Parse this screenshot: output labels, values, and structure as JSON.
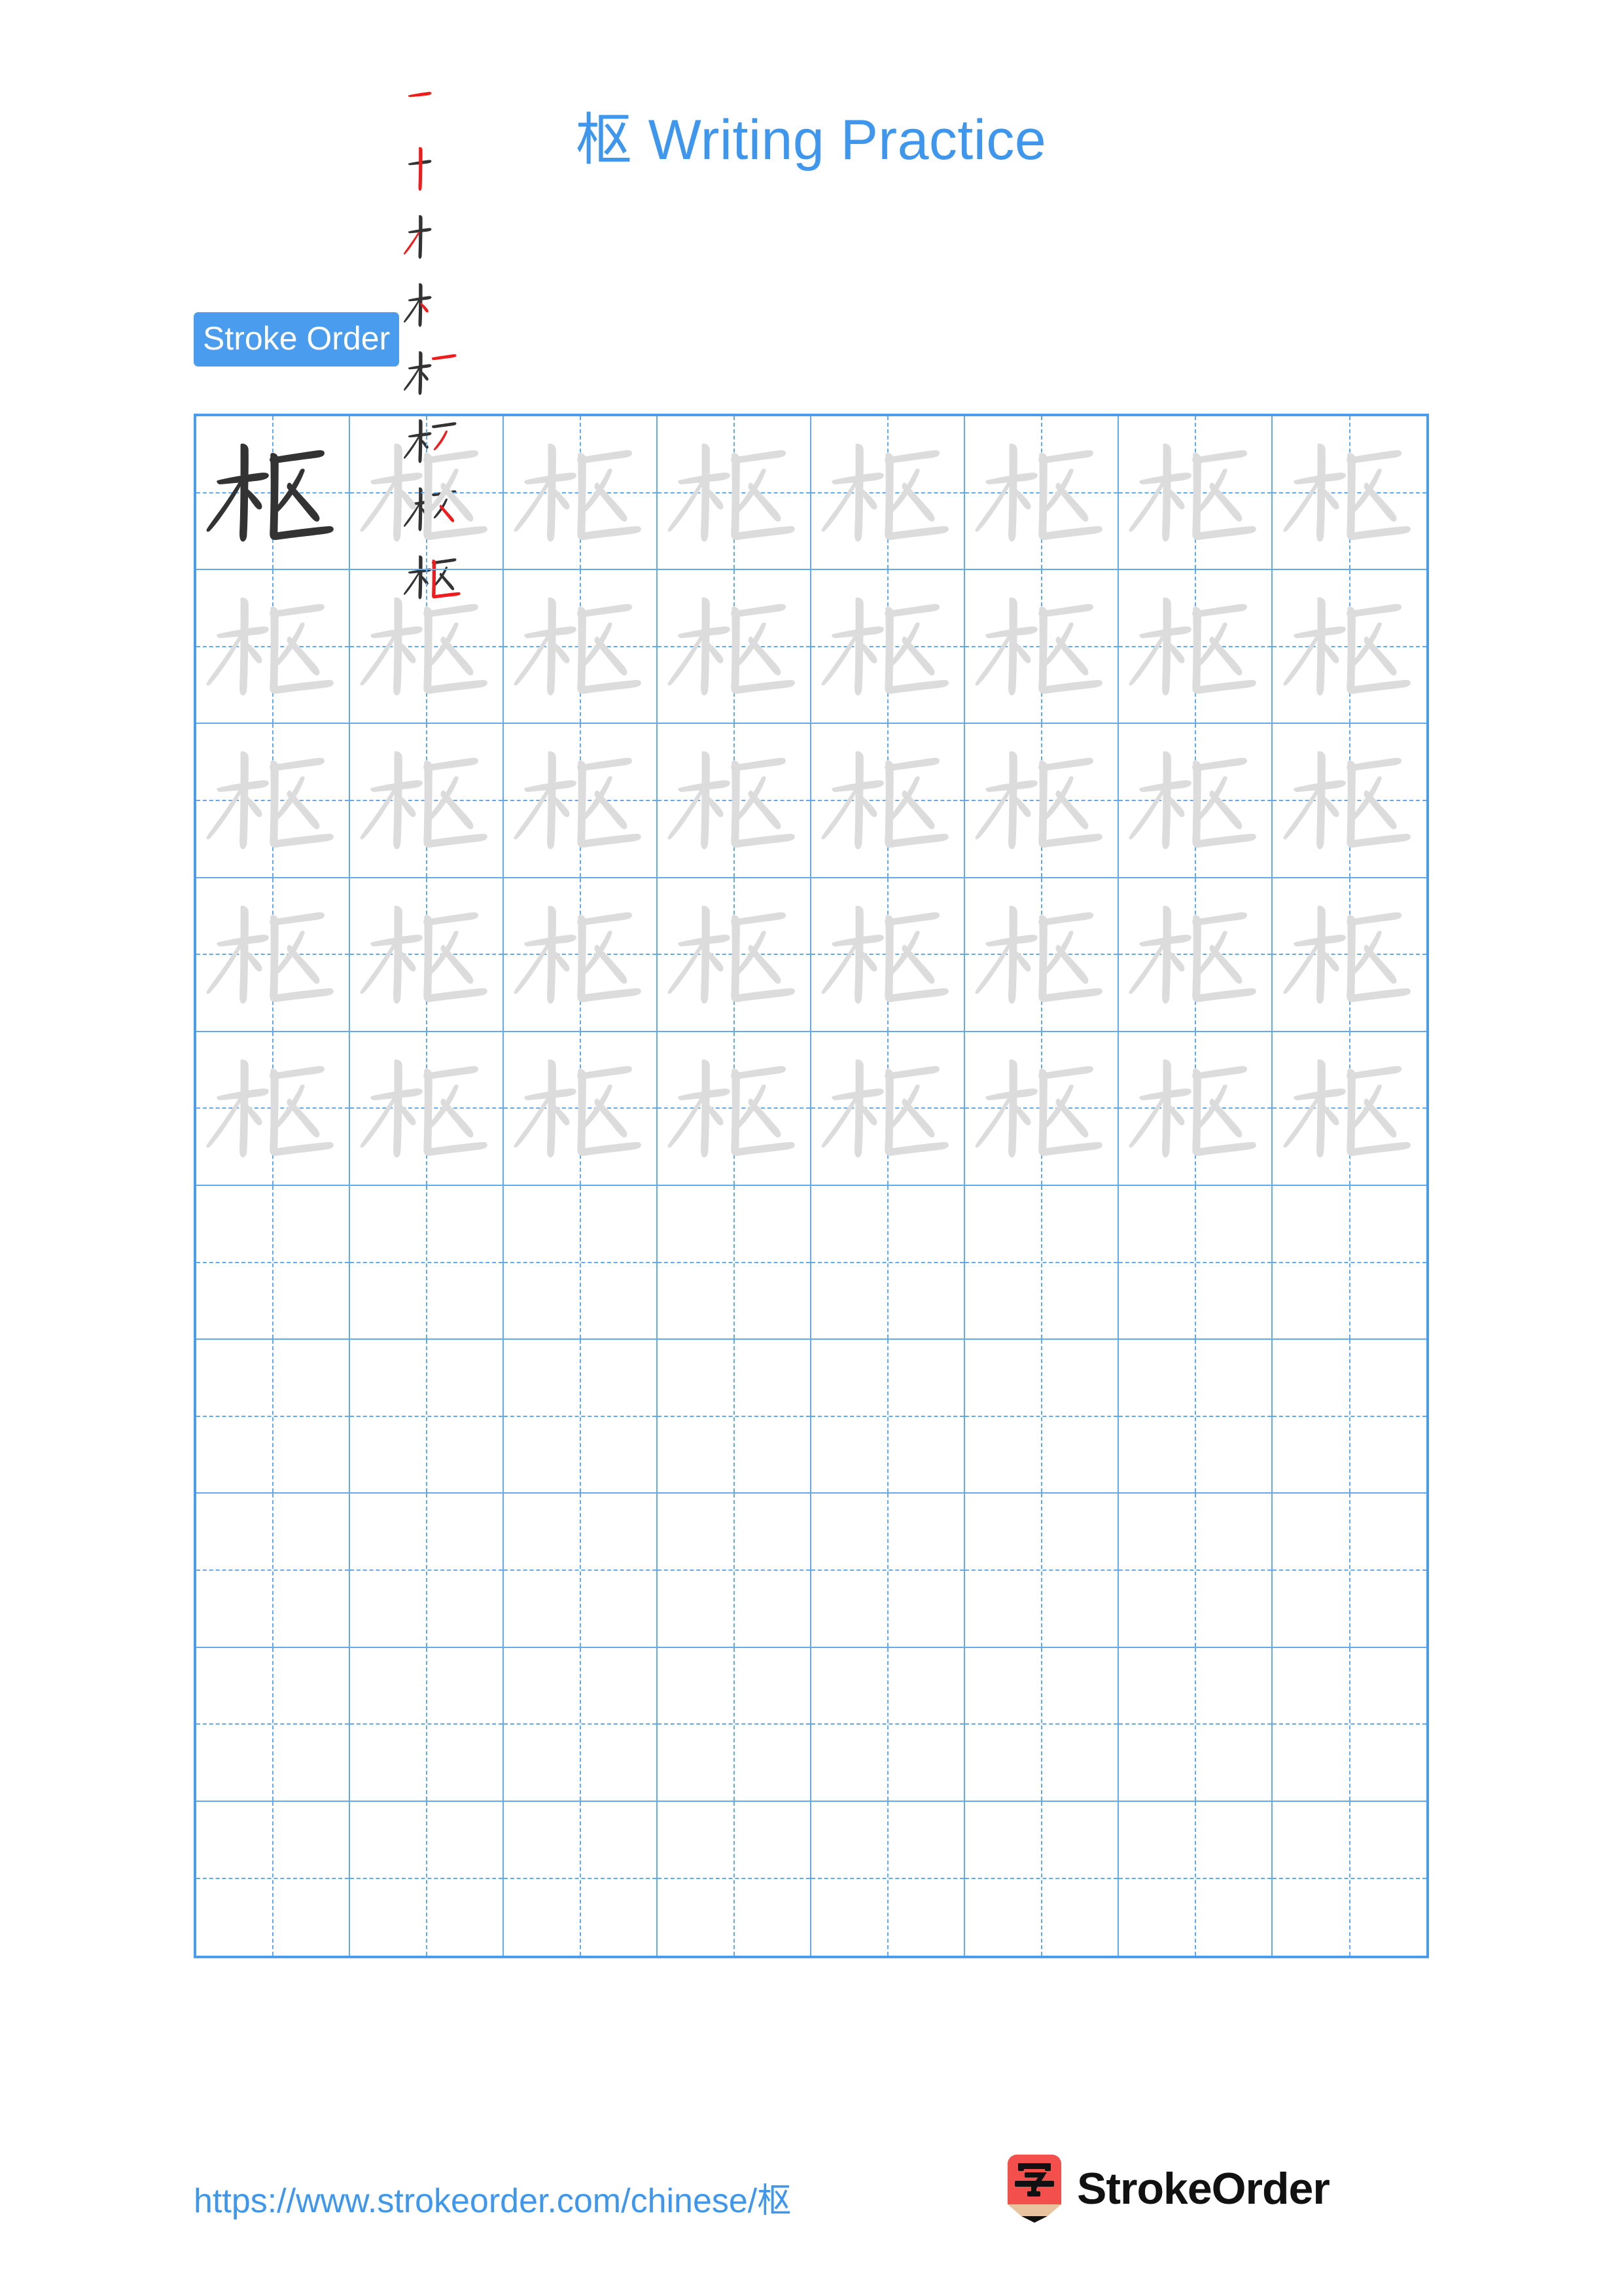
{
  "character": "枢",
  "title": "枢 Writing Practice",
  "colors": {
    "title_blue": "#3E97ED",
    "badge_blue": "#4A9CEE",
    "grid_blue": "#62A9EE",
    "grid_border_blue": "#4A9CEE",
    "trace_gray": "#DCDCDC",
    "ink_black": "#333333",
    "new_stroke_red": "#EE1C1C",
    "logo_red": "#F3504D",
    "logo_wood": "#E8C39E",
    "logo_tip": "#111111"
  },
  "stroke_order": {
    "label": "Stroke Order",
    "total_strokes": 8,
    "steps": [
      {
        "index": 1,
        "name": "heng",
        "description": "horizontal"
      },
      {
        "index": 2,
        "name": "shu",
        "description": "vertical"
      },
      {
        "index": 3,
        "name": "pie",
        "description": "left-falling"
      },
      {
        "index": 4,
        "name": "dian",
        "description": "dot"
      },
      {
        "index": 5,
        "name": "heng",
        "description": "horizontal top of right component"
      },
      {
        "index": 6,
        "name": "pie",
        "description": "left-falling in right component"
      },
      {
        "index": 7,
        "name": "na",
        "description": "right-falling in right component"
      },
      {
        "index": 8,
        "name": "shuzhewangou",
        "description": "enclosing hook"
      }
    ]
  },
  "grid": {
    "columns": 8,
    "rows": 10,
    "filled_rows": 5,
    "empty_rows": 5,
    "first_cell_style": "solid-dark",
    "trace_cell_style": "light-gray"
  },
  "footer": {
    "url": "https://www.strokeorder.com/chinese/枢",
    "logo_char": "字",
    "logo_text": "StrokeOrder"
  }
}
